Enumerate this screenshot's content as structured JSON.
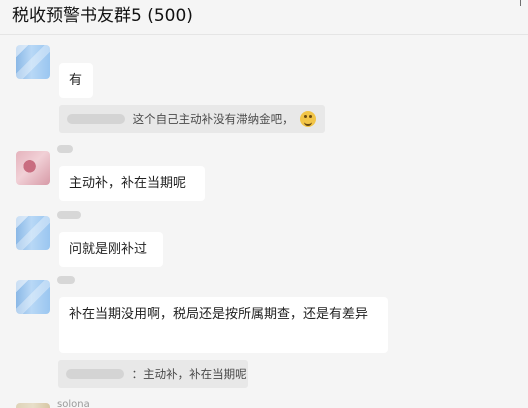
{
  "header": {
    "title": "税收预警书友群5 (500)"
  },
  "messages": [
    {
      "text": "有",
      "quote": {
        "text": "这个自己主动补没有滞纳金吧，"
      }
    },
    {
      "text": "主动补，补在当期呢"
    },
    {
      "text": "问就是刚补过"
    },
    {
      "text": "补在当期没用啊，税局还是按所属期查，还是有差异",
      "quote": {
        "text": "：主动补，补在当期呢"
      }
    }
  ],
  "footer": {
    "next_sender": "solona"
  },
  "icons": {
    "grinning": "grinning-face-emoji"
  }
}
